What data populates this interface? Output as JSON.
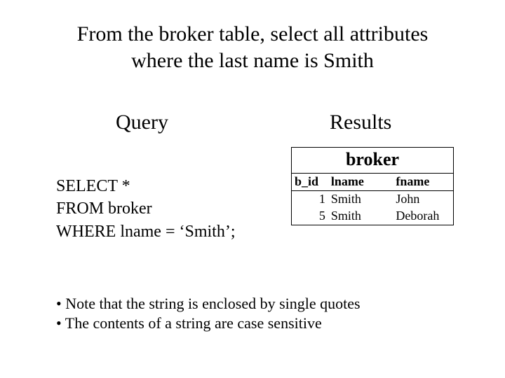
{
  "title_line1": "From the broker table, select all attributes",
  "title_line2": "where the last name is Smith",
  "subhead_query": "Query",
  "subhead_results": "Results",
  "query": {
    "line1": "SELECT *",
    "line2": "FROM broker",
    "line3": "WHERE lname = ‘Smith’;"
  },
  "table": {
    "title": "broker",
    "headers": {
      "c0": "b_id",
      "c1": "lname",
      "c2": "fname"
    },
    "rows": [
      {
        "b_id": "1",
        "lname": "Smith",
        "fname": "John"
      },
      {
        "b_id": "5",
        "lname": "Smith",
        "fname": "Deborah"
      }
    ]
  },
  "notes": {
    "n1": "• Note that the string is enclosed by single quotes",
    "n2": "• The contents of a string are case sensitive"
  }
}
